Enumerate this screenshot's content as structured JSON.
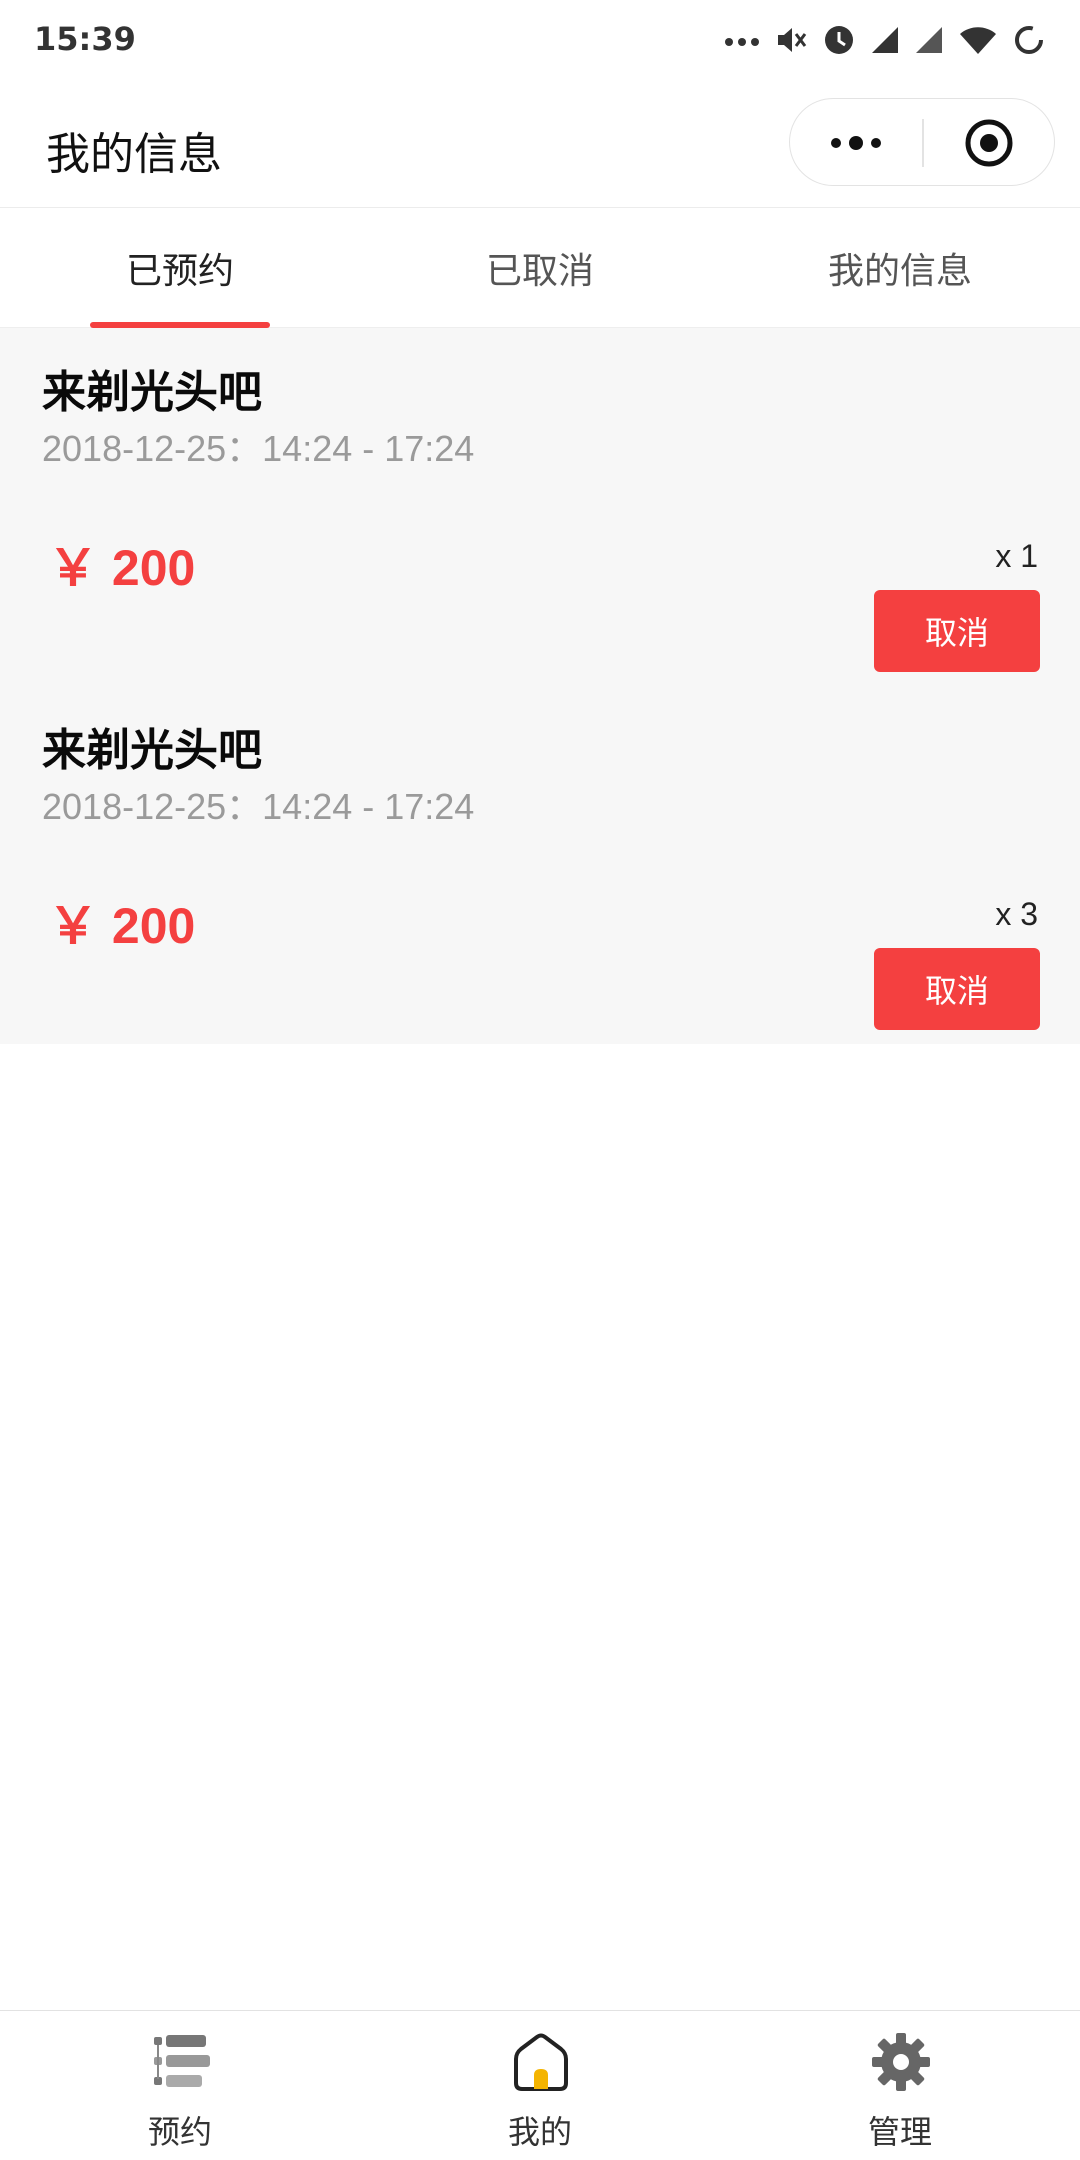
{
  "status_bar": {
    "time": "15:39",
    "icons": [
      "more-dots-icon",
      "mute-icon",
      "alarm-icon",
      "signal-icon",
      "signal-icon",
      "wifi-icon",
      "battery-ring-icon"
    ]
  },
  "nav": {
    "title": "我的信息",
    "capsule_icons": [
      "more-dots-icon",
      "close-target-icon"
    ]
  },
  "tabs": {
    "items": [
      {
        "label": "已预约",
        "active": true
      },
      {
        "label": "已取消",
        "active": false
      },
      {
        "label": "我的信息",
        "active": false
      }
    ],
    "accent": "#f44040"
  },
  "orders": [
    {
      "title": "来剃光头吧",
      "time": "2018-12-25：14:24 - 17:24",
      "price": "￥ 200",
      "qty": "x 1",
      "cancel_label": "取消"
    },
    {
      "title": "来剃光头吧",
      "time": "2018-12-25：14:24 - 17:24",
      "price": "￥ 200",
      "qty": "x 3",
      "cancel_label": "取消"
    }
  ],
  "tabbar": {
    "items": [
      {
        "label": "预约",
        "icon": "list-icon"
      },
      {
        "label": "我的",
        "icon": "home-icon"
      },
      {
        "label": "管理",
        "icon": "gear-icon"
      }
    ]
  },
  "colors": {
    "accent_red": "#f44040",
    "list_background": "#f7f7f7",
    "secondary_text": "#9a9a9a"
  }
}
